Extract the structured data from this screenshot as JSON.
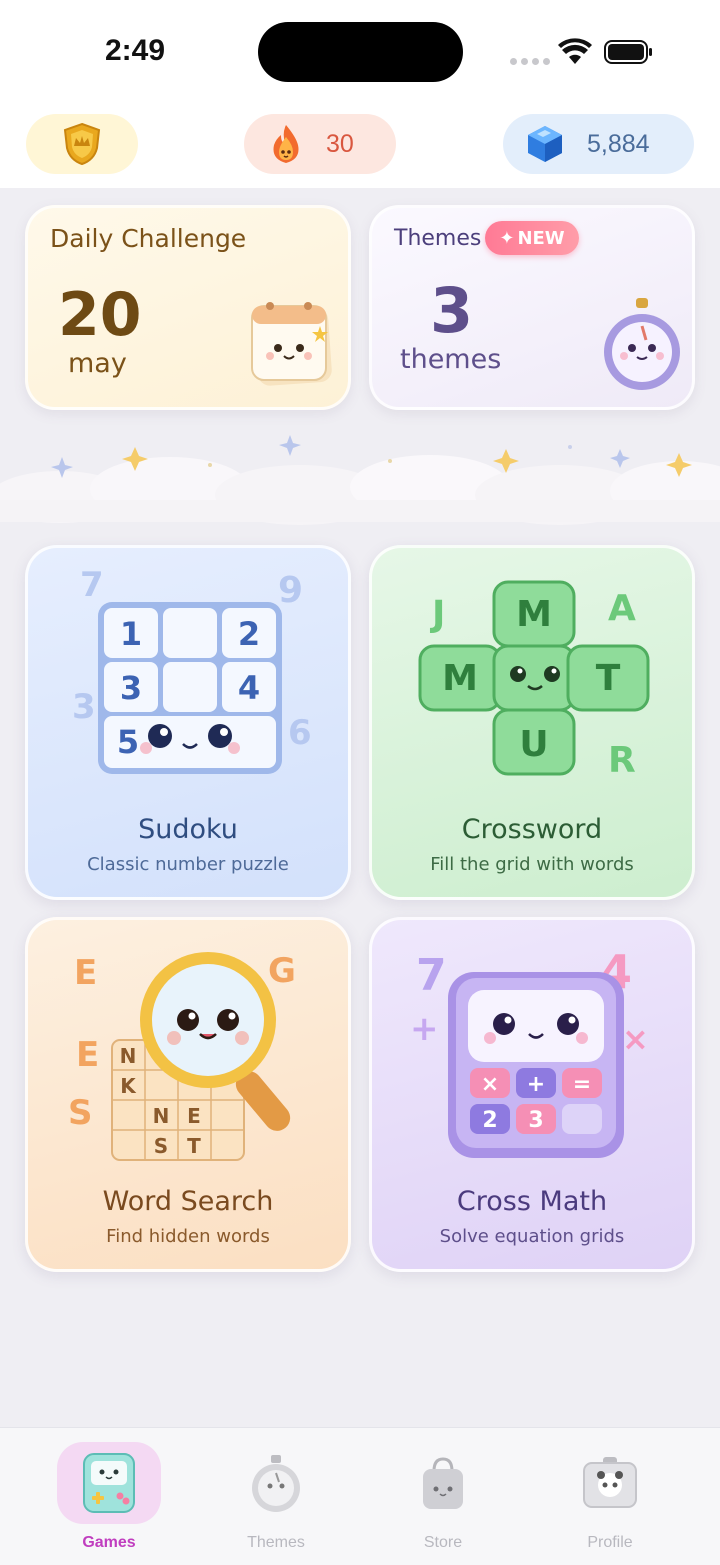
{
  "status_bar": {
    "time": "2:49"
  },
  "currency": {
    "streak": "30",
    "gems": "5,884",
    "shield_icon": "shield-crown-icon",
    "streak_icon": "fire-icon",
    "gems_icon": "gem-icon"
  },
  "daily_challenge": {
    "title": "Daily Challenge",
    "day": "20",
    "month": "may"
  },
  "themes_card": {
    "title": "Themes",
    "badge": "NEW",
    "count": "3",
    "label": "themes"
  },
  "games": [
    {
      "title": "Sudoku",
      "subtitle": "Classic number puzzle"
    },
    {
      "title": "Crossword",
      "subtitle": "Fill the grid with words"
    },
    {
      "title": "Word Search",
      "subtitle": "Find hidden words"
    },
    {
      "title": "Cross Math",
      "subtitle": "Solve equation grids"
    }
  ],
  "sudoku_art": {
    "cells": [
      "1",
      "",
      "2",
      "3",
      "",
      "4",
      "5",
      "",
      ""
    ],
    "floating": [
      "7",
      "9",
      "3",
      "6"
    ]
  },
  "crossword_art": {
    "tiles": [
      "M",
      "M",
      "",
      "T",
      "U"
    ],
    "floating": [
      "J",
      "A",
      "R"
    ]
  },
  "wordsearch_art": {
    "letters": [
      "E",
      "G",
      "E",
      "S",
      "N",
      "K",
      "N",
      "E",
      "S",
      "T"
    ]
  },
  "crossmath_art": {
    "numbers": [
      "7",
      "4"
    ],
    "keys": [
      "×",
      "+",
      "=",
      "2",
      "3",
      ""
    ]
  },
  "tabs": [
    {
      "label": "Games",
      "active": true
    },
    {
      "label": "Themes",
      "active": false
    },
    {
      "label": "Store",
      "active": false
    },
    {
      "label": "Profile",
      "active": false
    }
  ],
  "colors": {
    "accent": "#c03dbf",
    "background": "#efeef3"
  }
}
